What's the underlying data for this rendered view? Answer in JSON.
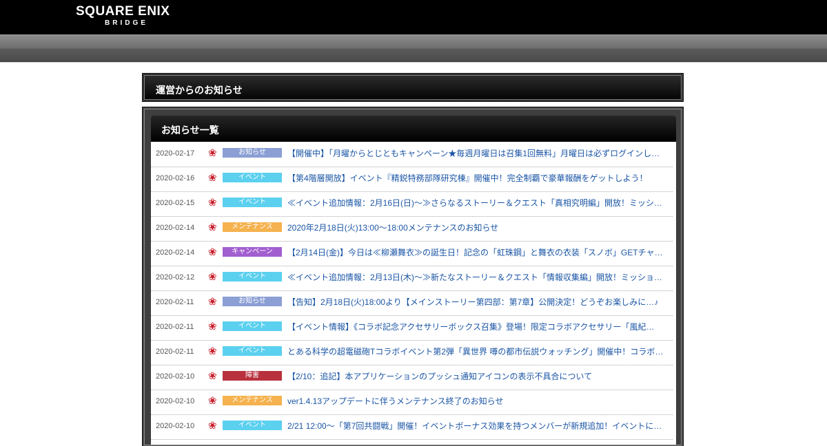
{
  "brand": {
    "name": "SQUARE ENIX",
    "sub": "BRIDGE"
  },
  "page": {
    "title": "運営からのお知らせ"
  },
  "list": {
    "title": "お知らせ一覧",
    "items": [
      {
        "date": "2020-02-17",
        "category": "お知らせ",
        "category_color": "#8b9fd4",
        "title": "【開催中】「月曜からとじともキャンペーン★毎週月曜日は召集1回無料」月曜日は必ずログインし…"
      },
      {
        "date": "2020-02-16",
        "category": "イベント",
        "category_color": "#5bd0ef",
        "title": "【第4階層開放】イベント『精鋭特務部隊研究棟』開催中！完全制覇で豪華報酬をゲットしよう！"
      },
      {
        "date": "2020-02-15",
        "category": "イベント",
        "category_color": "#5bd0ef",
        "title": "≪イベント追加情報：2月16日(日)～≫さらなるストーリー＆クエスト「真相究明編」開放！ミッシ…"
      },
      {
        "date": "2020-02-14",
        "category": "メンテナンス",
        "category_color": "#f5b24e",
        "title": "2020年2月18日(火)13:00～18:00メンテナンスのお知らせ"
      },
      {
        "date": "2020-02-14",
        "category": "キャンペーン",
        "category_color": "#a25fcf",
        "title": "【2月14日(金)】今日は≪柳瀬舞衣≫の誕生日！記念の「虹珠鋼」と舞衣の衣装「スノボ」GETチャ…"
      },
      {
        "date": "2020-02-12",
        "category": "イベント",
        "category_color": "#5bd0ef",
        "title": "≪イベント追加情報：2月13日(木)～≫新たなストーリー＆クエスト「情報収集編」開放！ミッショ…"
      },
      {
        "date": "2020-02-11",
        "category": "お知らせ",
        "category_color": "#8b9fd4",
        "title": "【告知】2月18日(火)18:00より【メインストーリー第四部：第7章】公開決定！どうぞお楽しみに…♪"
      },
      {
        "date": "2020-02-11",
        "category": "イベント",
        "category_color": "#5bd0ef",
        "title": "【イベント情報】《コラボ記念アクセサリーボックス召集》登場！限定コラボアクセサリー「風紀…"
      },
      {
        "date": "2020-02-11",
        "category": "イベント",
        "category_color": "#5bd0ef",
        "title": "とある科学の超電磁砲Tコラボイベント第2弾「異世界 噂の都市伝説ウォッチング」開催中！コラボ…"
      },
      {
        "date": "2020-02-10",
        "category": "障害",
        "category_color": "#b8313d",
        "title": "【2/10：追記】本アプリケーションのプッシュ通知アイコンの表示不具合について"
      },
      {
        "date": "2020-02-10",
        "category": "メンテナンス",
        "category_color": "#f5b24e",
        "title": "ver1.4.13アップデートに伴うメンテナンス終了のお知らせ"
      },
      {
        "date": "2020-02-10",
        "category": "イベント",
        "category_color": "#5bd0ef",
        "title": "2/21 12:00～「第7回共闘戦」開催！イベントボーナス効果を持つメンバーが新規追加！イベントに…"
      }
    ]
  }
}
